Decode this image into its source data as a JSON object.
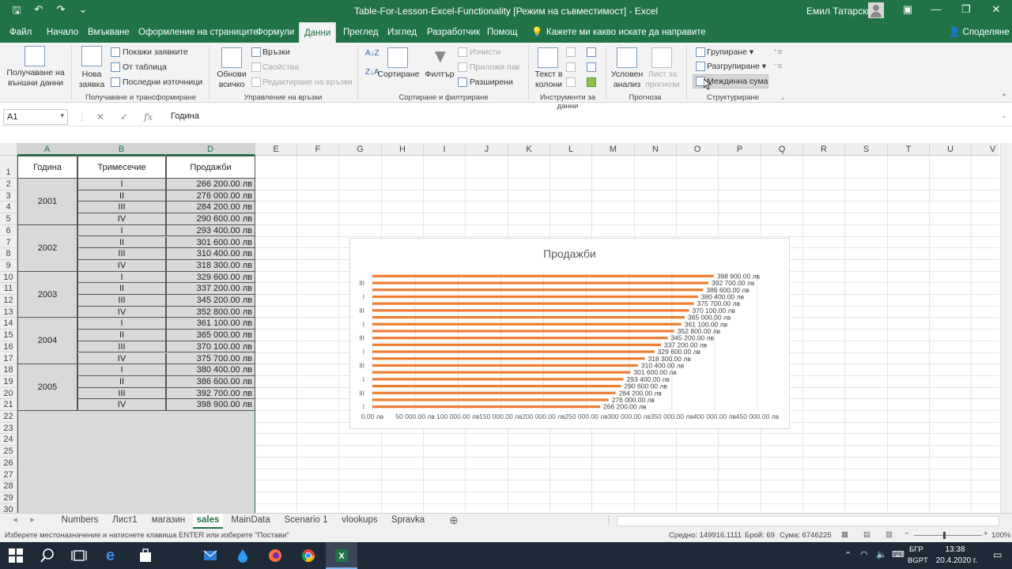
{
  "titlebar": {
    "title": "Table-For-Lesson-Excel-Functionality  [Режим на съвместимост]  -  Excel",
    "user": "Емил Татарски"
  },
  "ribbon_tabs": [
    "Файл",
    "Начало",
    "Вмъкване",
    "Оформление на страниците",
    "Формули",
    "Данни",
    "Преглед",
    "Изглед",
    "Разработчик",
    "Помощ"
  ],
  "tell_me": "Кажете ми какво искате да направите",
  "share": "Споделяне",
  "ribbon": {
    "get_external": "Получаване на\nвъншни данни",
    "new_query": "Нова\nзаявка",
    "show_queries": "Покажи заявките",
    "from_table": "От таблица",
    "recent_sources": "Последни източници",
    "group_get_transform": "Получаване и трансформиране",
    "refresh_all": "Обнови\nвсичко",
    "connections": "Връзки",
    "properties": "Свойства",
    "edit_links": "Редактиране на връзки",
    "group_connections": "Управление на връзки",
    "sort": "Сортиране",
    "filter": "Филтър",
    "clear": "Изчисти",
    "reapply": "Приложи пак",
    "advanced": "Разширени",
    "group_sort_filter": "Сортиране и филтриране",
    "text_to_columns": "Текст в\nколони",
    "group_data_tools": "Инструменти за данни",
    "what_if": "Условен\nанализ",
    "forecast_sheet": "Лист за\nпрогнози",
    "group_forecast": "Прогноза",
    "group_btn": "Групиране",
    "ungroup_btn": "Разгрупиране",
    "subtotal_btn": "Междинна сума",
    "group_outline": "Структуриране"
  },
  "formula_bar": {
    "name_box": "A1",
    "formula": "Година"
  },
  "grid": {
    "columns": [
      "A",
      "B",
      "D",
      "E",
      "F",
      "G",
      "H",
      "I",
      "J",
      "K",
      "L",
      "M",
      "N",
      "O",
      "P",
      "Q",
      "R",
      "S",
      "T",
      "U",
      "V"
    ],
    "headers": [
      "Година",
      "Тримесечие",
      "Продажби"
    ],
    "year_groups": [
      {
        "year": "2001",
        "first_row": 2
      },
      {
        "year": "2002",
        "first_row": 6
      },
      {
        "year": "2003",
        "first_row": 10
      },
      {
        "year": "2004",
        "first_row": 14
      },
      {
        "year": "2005",
        "first_row": 18
      }
    ],
    "quarters": [
      "I",
      "II",
      "III",
      "IV",
      "I",
      "II",
      "III",
      "IV",
      "I",
      "II",
      "III",
      "IV",
      "I",
      "II",
      "III",
      "IV",
      "I",
      "II",
      "III",
      "IV"
    ],
    "sales": [
      "266 200.00 лв",
      "276 000.00 лв",
      "284 200.00 лв",
      "290 600.00 лв",
      "293 400.00 лв",
      "301 600.00 лв",
      "310 400.00 лв",
      "318 300.00 лв",
      "329 600.00 лв",
      "337 200.00 лв",
      "345 200.00 лв",
      "352 800.00 лв",
      "361 100.00 лв",
      "365 000.00 лв",
      "370 100.00 лв",
      "375 700.00 лв",
      "380 400.00 лв",
      "386 600.00 лв",
      "392 700.00 лв",
      "398 900.00 лв"
    ],
    "row_count": 30
  },
  "chart_data": {
    "type": "bar",
    "orientation": "horizontal",
    "title": "Продажби",
    "categories": [
      "I",
      "II",
      "III",
      "IV",
      "I",
      "II",
      "III",
      "IV",
      "I",
      "II",
      "III",
      "IV",
      "I",
      "II",
      "III",
      "IV",
      "I",
      "II",
      "III",
      "IV"
    ],
    "category_tick_labels": [
      "I",
      "III",
      "I",
      "III",
      "I",
      "III",
      "I",
      "III",
      "I",
      "III"
    ],
    "values": [
      266200,
      276000,
      284200,
      290600,
      293400,
      301600,
      310400,
      318300,
      329600,
      337200,
      345200,
      352800,
      361100,
      365000,
      370100,
      375700,
      380400,
      386600,
      392700,
      398900
    ],
    "data_labels": [
      "266 200.00 лв",
      "276 000.00 лв",
      "284 200.00 лв",
      "290 600.00 лв",
      "293 400.00 лв",
      "301 600.00 лв",
      "310 400.00 лв",
      "318 300.00 лв",
      "329 600.00 лв",
      "337 200.00 лв",
      "345 200.00 лв",
      "352 800.00 лв",
      "361 100.00 лв",
      "365 000.00 лв",
      "370 100.00 лв",
      "375 700.00 лв",
      "380 400.00 лв",
      "386 600.00 лв",
      "392 700.00 лв",
      "398 900.00 лв"
    ],
    "xlim": [
      0,
      450000
    ],
    "x_tick_labels": [
      "0.00 лв",
      "50 000.00 лв",
      "100 000.00 лв",
      "150 000.00 лв",
      "200 000.00 лв",
      "250 000.00 лв",
      "300 000.00 лв",
      "350 000.00 лв",
      "400 000.00 лв",
      "450 000.00 лв"
    ],
    "grid": true,
    "color": "#ED7D31"
  },
  "sheet_tabs": [
    "Numbers",
    "Лист1",
    "магазин",
    "sales",
    "MainData",
    "Scenario 1",
    "vlookups",
    "Spravka"
  ],
  "active_sheet": "sales",
  "status": {
    "message": "Изберете местоназначение и натиснете клавиша ENTER или изберете \"Постави\"",
    "average": "Средно: 149916.1111",
    "count": "Брой: 69",
    "sum": "Сума: 6746225",
    "zoom": "100%"
  },
  "taskbar": {
    "lang": "БГР",
    "lang2": "BGPT",
    "time": "13:38",
    "date": "20.4.2020 г."
  },
  "colors": {
    "excel_green": "#217346",
    "bar_orange": "#ED7D31",
    "selection_gray": "#D9D9D9"
  }
}
